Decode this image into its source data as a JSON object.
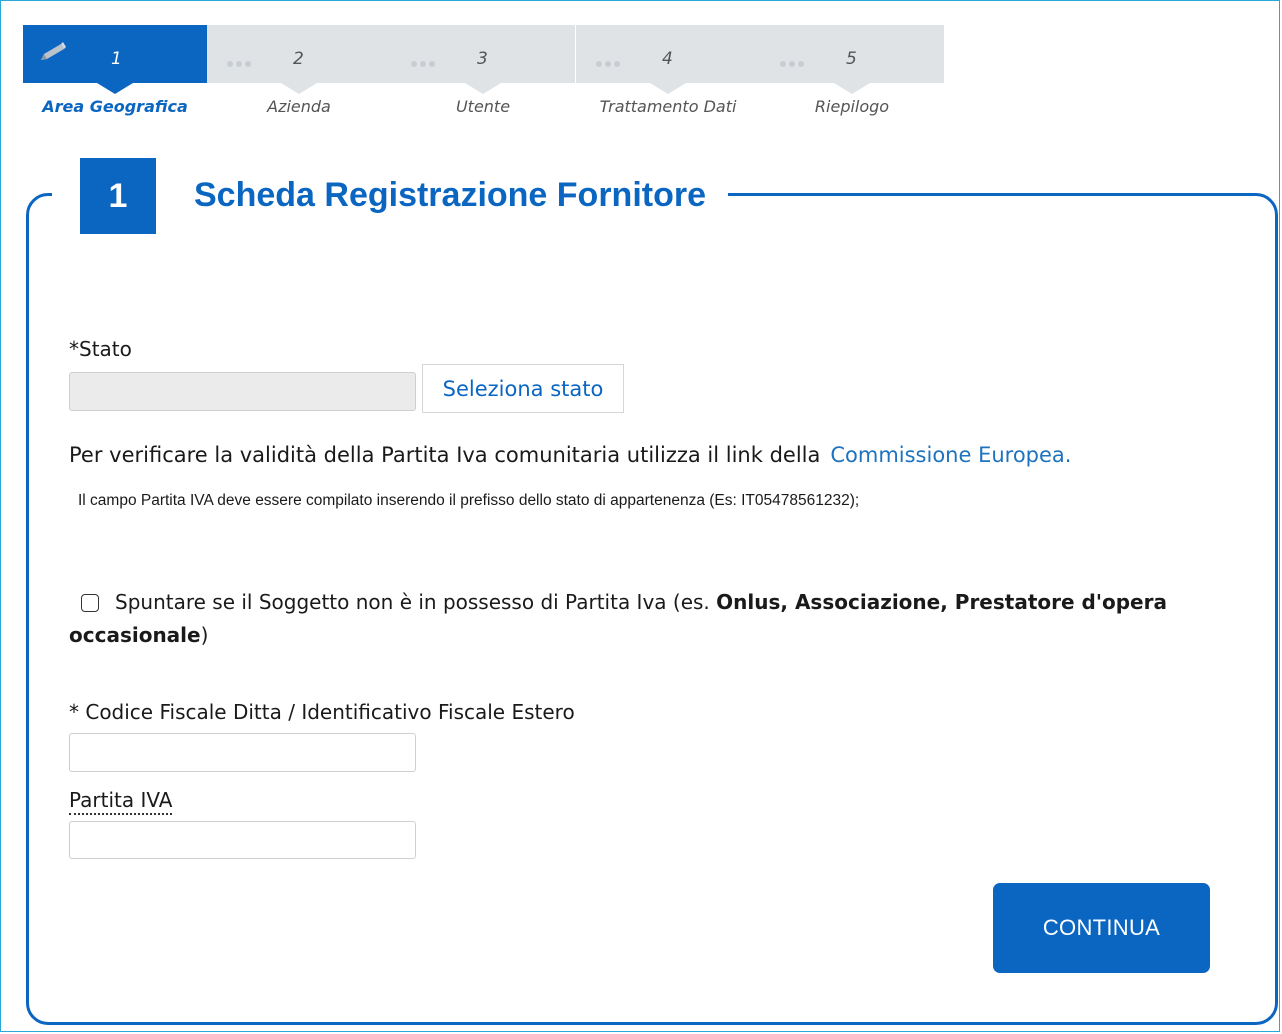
{
  "stepper": {
    "steps": [
      {
        "number": "1",
        "label": "Area Geografica",
        "active": true,
        "icon": "pencil-icon"
      },
      {
        "number": "2",
        "label": "Azienda",
        "active": false
      },
      {
        "number": "3",
        "label": "Utente",
        "active": false
      },
      {
        "number": "4",
        "label": "Trattamento Dati",
        "active": false
      },
      {
        "number": "5",
        "label": "Riepilogo",
        "active": false
      }
    ]
  },
  "form": {
    "section_number": "1",
    "title": "Scheda Registrazione Fornitore",
    "stato_label": "*Stato",
    "stato_value": "",
    "select_button": "Seleziona stato",
    "info_text": "Per verificare la validità della Partita Iva comunitaria utilizza il link della",
    "info_link": "Commissione Europea.",
    "hint": "Il campo Partita IVA deve essere compilato inserendo il prefisso dello stato di appartenenza (Es: IT05478561232);",
    "checkbox": {
      "text_before": "Spuntare se il Soggetto non è in possesso di Partita Iva (es. ",
      "text_bold": "Onlus, Associazione, Prestatore d'opera occasionale",
      "text_after": ")",
      "checked": false
    },
    "codice_fiscale_label": "* Codice Fiscale Ditta / Identificativo Fiscale Estero",
    "codice_fiscale_value": "",
    "partita_iva_label": "Partita IVA",
    "partita_iva_value": "",
    "continue_button": "CONTINUA"
  },
  "colors": {
    "accent": "#0b66c2",
    "link": "#1e73be",
    "step_inactive": "#dfe3e6",
    "frame": "#2aa9d6"
  }
}
